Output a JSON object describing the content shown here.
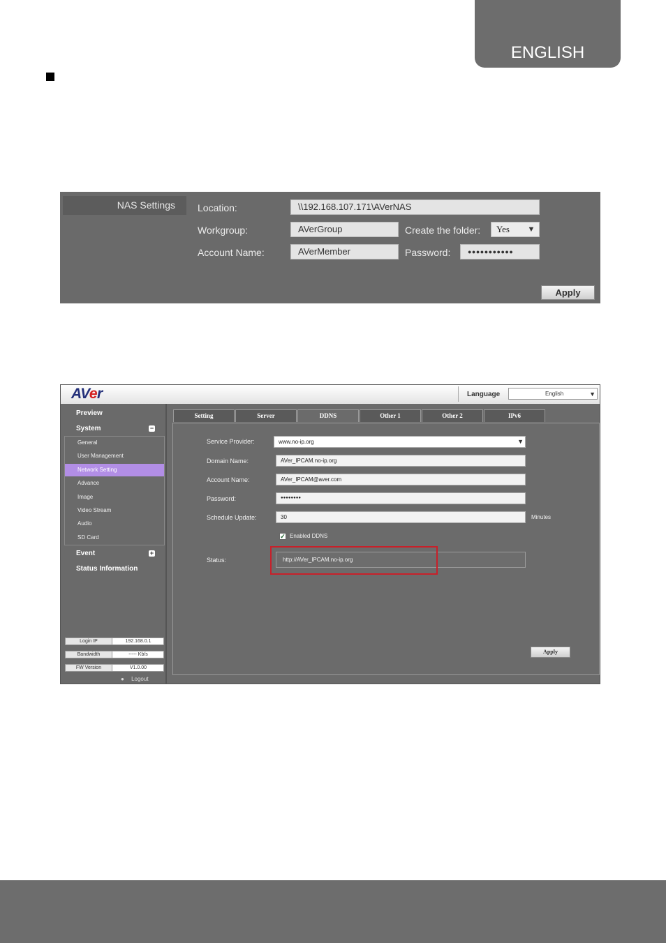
{
  "page": {
    "language_tab": "ENGLISH"
  },
  "nas": {
    "title": "NAS Settings",
    "location_label": "Location:",
    "location_value": "\\\\192.168.107.171\\AVerNAS",
    "workgroup_label": "Workgroup:",
    "workgroup_value": "AVerGroup",
    "create_folder_label": "Create the folder:",
    "create_folder_value": "Yes",
    "account_label": "Account Name:",
    "account_value": "AVerMember",
    "password_label": "Password:",
    "password_value": "●●●●●●●●●●●",
    "apply": "Apply"
  },
  "app": {
    "logo_a": "AV",
    "logo_e": "e",
    "logo_r": "r",
    "language_label": "Language",
    "language_value": "English",
    "sidebar": {
      "preview": "Preview",
      "system": "System",
      "system_toggle": "−",
      "items": [
        {
          "label": "General"
        },
        {
          "label": "User Management"
        },
        {
          "label": "Network Setting"
        },
        {
          "label": "Advance"
        },
        {
          "label": "Image"
        },
        {
          "label": "Video Stream"
        },
        {
          "label": "Audio"
        },
        {
          "label": "SD Card"
        }
      ],
      "event": "Event",
      "event_toggle": "+",
      "status_info": "Status Information",
      "login_ip_label": "Login IP",
      "login_ip_value": "192.168.0.1",
      "bandwidth_label": "Bandwidth",
      "bandwidth_value": "----- Kb/s",
      "fw_label": "FW Version",
      "fw_value": "V1.0.00",
      "logout": "Logout"
    },
    "tabs": [
      "Setting",
      "Server",
      "DDNS",
      "Other 1",
      "Other 2",
      "IPv6"
    ],
    "ddns": {
      "provider_label": "Service Provider:",
      "provider_value": "www.no-ip.org",
      "domain_label": "Domain Name:",
      "domain_value": "AVer_IPCAM.no-ip.org",
      "account_label": "Account Name:",
      "account_value": "AVer_IPCAM@aver.com",
      "password_label": "Password:",
      "password_value": "●●●●●●●●",
      "schedule_label": "Schedule Update:",
      "schedule_value": "30",
      "schedule_unit": "Minutes",
      "enabled_label": "Enabled DDNS",
      "enabled_check": "✓",
      "status_label": "Status:",
      "status_value": "http://AVer_IPCAM.no-ip.org",
      "apply": "Apply"
    }
  }
}
